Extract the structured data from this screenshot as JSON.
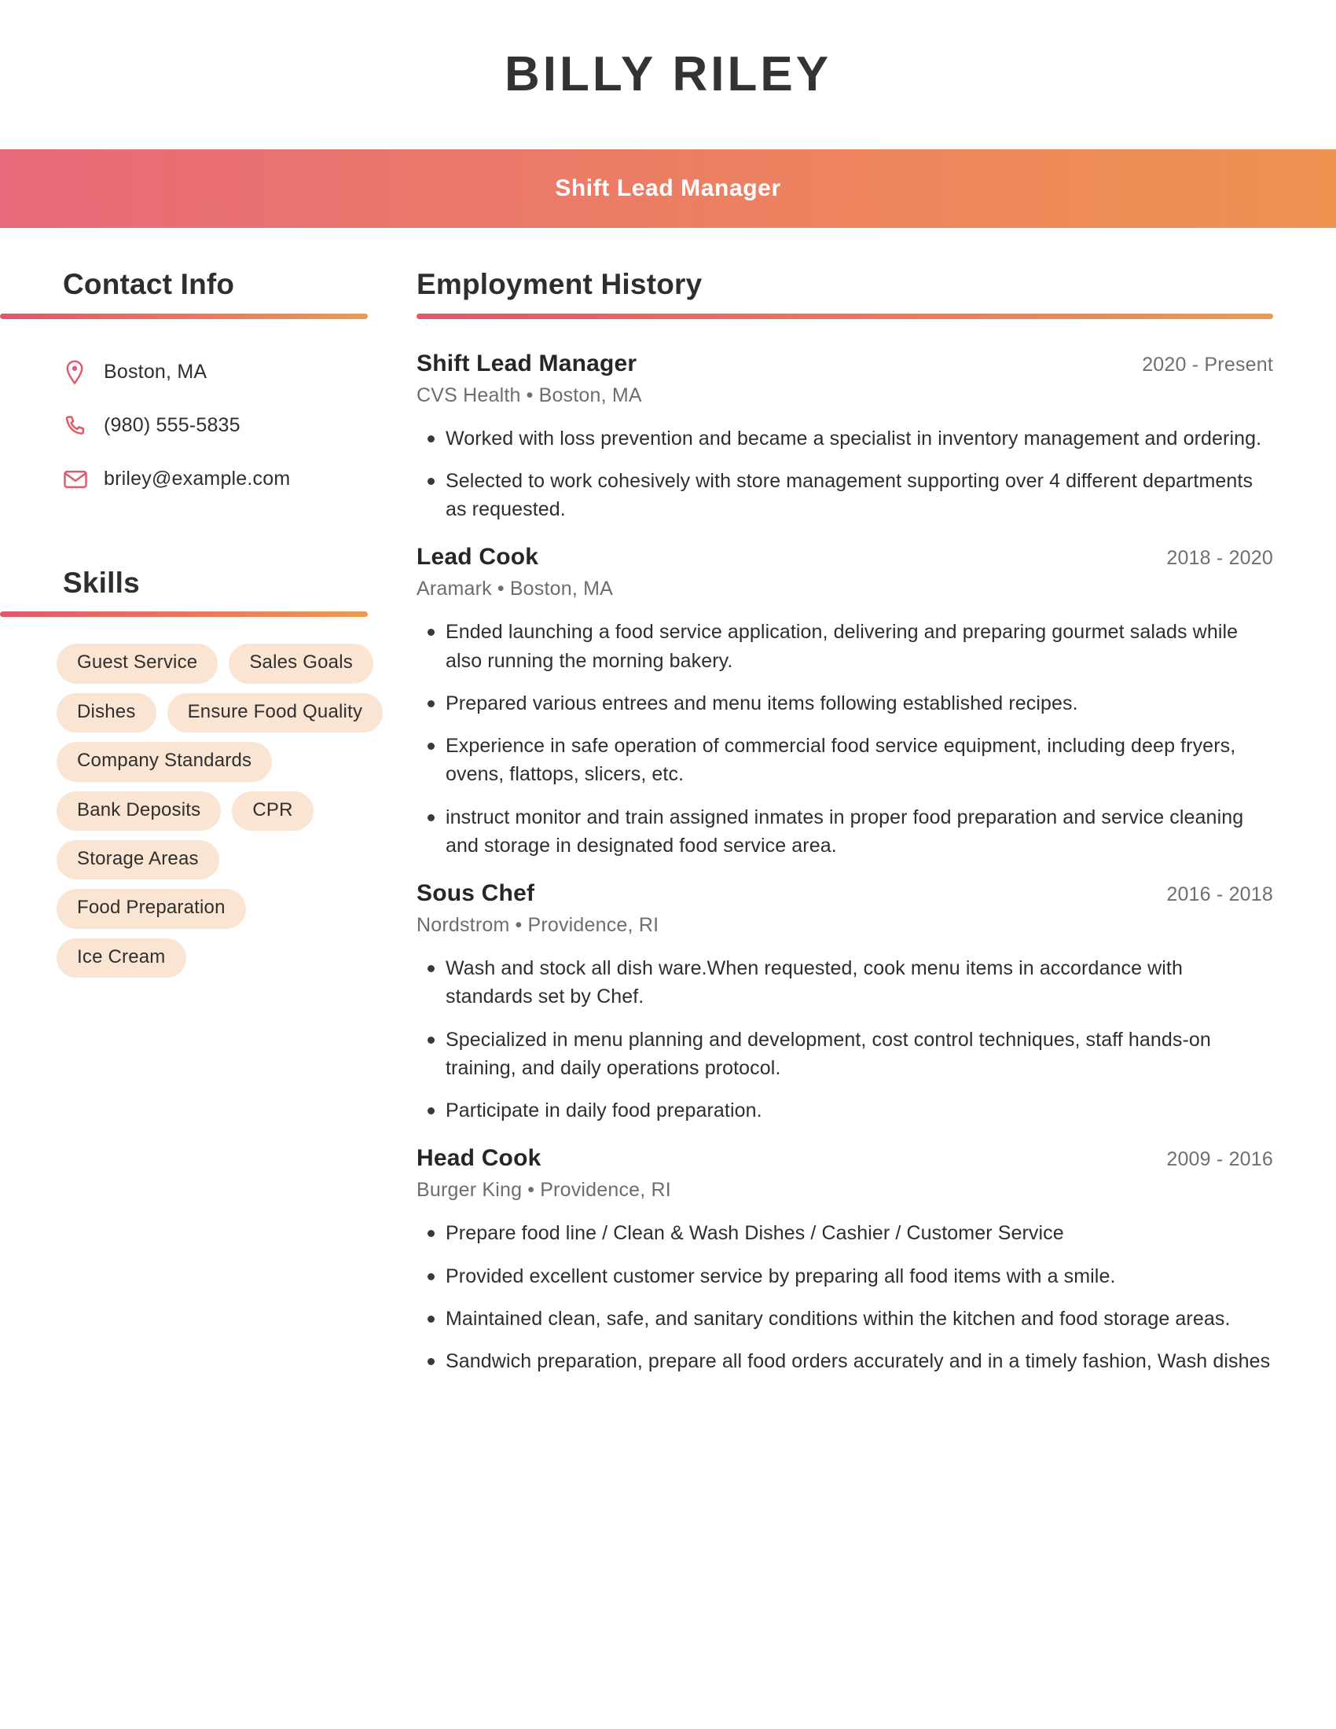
{
  "header": {
    "full_name": "BILLY RILEY",
    "job_title": "Shift Lead Manager",
    "accent_start": "#E8697A",
    "accent_end": "#EF9350"
  },
  "sidebar": {
    "contact": {
      "heading": "Contact Info",
      "items": [
        {
          "icon": "map-pin-icon",
          "value": "Boston, MA"
        },
        {
          "icon": "phone-icon",
          "value": "(980) 555-5835"
        },
        {
          "icon": "envelope-icon",
          "value": "briley@example.com"
        }
      ]
    },
    "skills": {
      "heading": "Skills",
      "pill_background": "#FAE5D3",
      "items": [
        "Guest Service",
        "Sales Goals",
        "Dishes",
        "Ensure Food Quality",
        "Company Standards",
        "Bank Deposits",
        "CPR",
        "Storage Areas",
        "Food Preparation",
        "Ice Cream"
      ]
    }
  },
  "main": {
    "employment": {
      "heading": "Employment History",
      "jobs": [
        {
          "role": "Shift Lead Manager",
          "dates": "2020 - Present",
          "company": "CVS Health",
          "location": "Boston, MA",
          "bullets": [
            "Worked with loss prevention and became a specialist in inventory management and ordering.",
            "Selected to work cohesively with store management supporting over 4 different departments as requested."
          ]
        },
        {
          "role": "Lead Cook",
          "dates": "2018 - 2020",
          "company": "Aramark",
          "location": "Boston, MA",
          "bullets": [
            "Ended launching a food service application, delivering and preparing gourmet salads while also running the morning bakery.",
            "Prepared various entrees and menu items following established recipes.",
            "Experience in safe operation of commercial food service equipment, including deep fryers, ovens, flattops, slicers, etc.",
            "instruct monitor and train assigned inmates in proper food preparation and service cleaning and storage in designated food service area."
          ]
        },
        {
          "role": "Sous Chef",
          "dates": "2016 - 2018",
          "company": "Nordstrom",
          "location": "Providence, RI",
          "bullets": [
            "Wash and stock all dish ware.When requested, cook menu items in accordance with standards set by Chef.",
            "Specialized in menu planning and development, cost control techniques, staff hands-on training, and daily operations protocol.",
            "Participate in daily food preparation."
          ]
        },
        {
          "role": "Head Cook",
          "dates": "2009 - 2016",
          "company": "Burger King",
          "location": "Providence, RI",
          "bullets": [
            "Prepare food line / Clean & Wash Dishes / Cashier / Customer Service",
            "Provided excellent customer service by preparing all food items with a smile.",
            "Maintained clean, safe, and sanitary conditions within the kitchen and food storage areas.",
            "Sandwich preparation, prepare all food orders accurately and in a timely fashion, Wash dishes"
          ]
        }
      ]
    }
  },
  "separator": "•"
}
